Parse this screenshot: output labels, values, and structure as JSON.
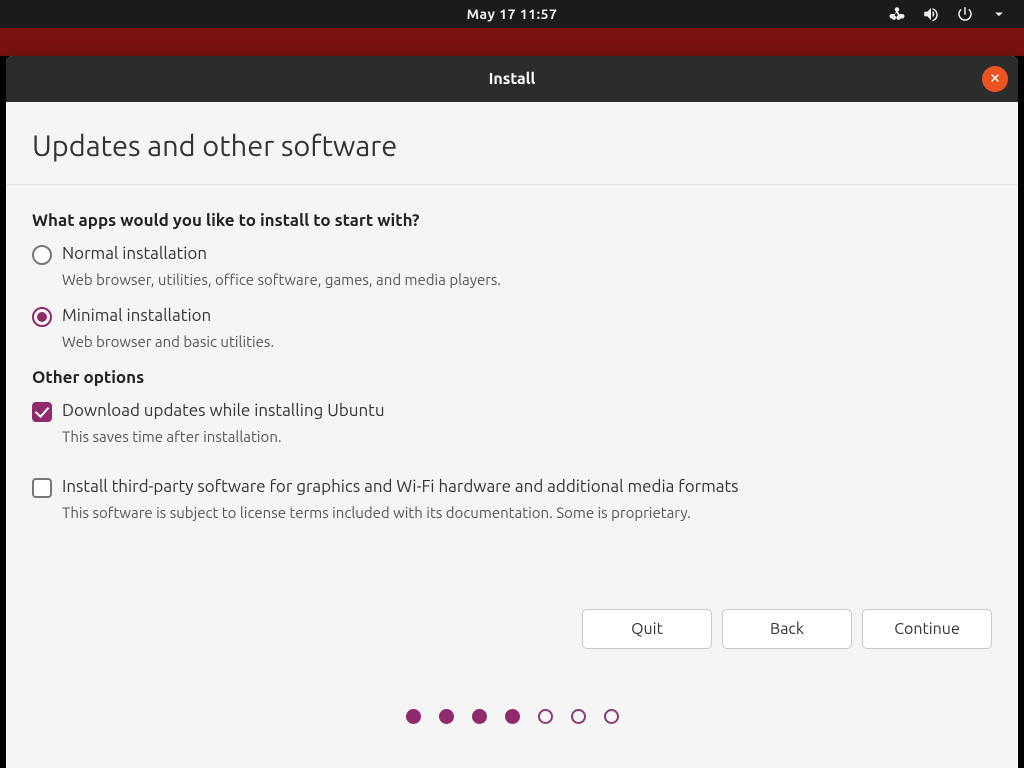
{
  "topbar": {
    "datetime": "May 17  11:57"
  },
  "window": {
    "title": "Install"
  },
  "page": {
    "title": "Updates and other software"
  },
  "install_type": {
    "heading": "What apps would you like to install to start with?",
    "normal": {
      "label": "Normal installation",
      "desc": "Web browser, utilities, office software, games, and media players.",
      "selected": false
    },
    "minimal": {
      "label": "Minimal installation",
      "desc": "Web browser and basic utilities.",
      "selected": true
    }
  },
  "other_options": {
    "heading": "Other options",
    "download_updates": {
      "label": "Download updates while installing Ubuntu",
      "desc": "This saves time after installation.",
      "checked": true
    },
    "third_party": {
      "label": "Install third-party software for graphics and Wi-Fi hardware and additional media formats",
      "desc": "This software is subject to license terms included with its documentation. Some is proprietary.",
      "checked": false
    }
  },
  "buttons": {
    "quit": "Quit",
    "back": "Back",
    "continue": "Continue"
  },
  "progress": {
    "total": 7,
    "current": 4
  },
  "colors": {
    "accent": "#902a6d",
    "orange": "#e95420",
    "red_strip": "#7a1212"
  }
}
